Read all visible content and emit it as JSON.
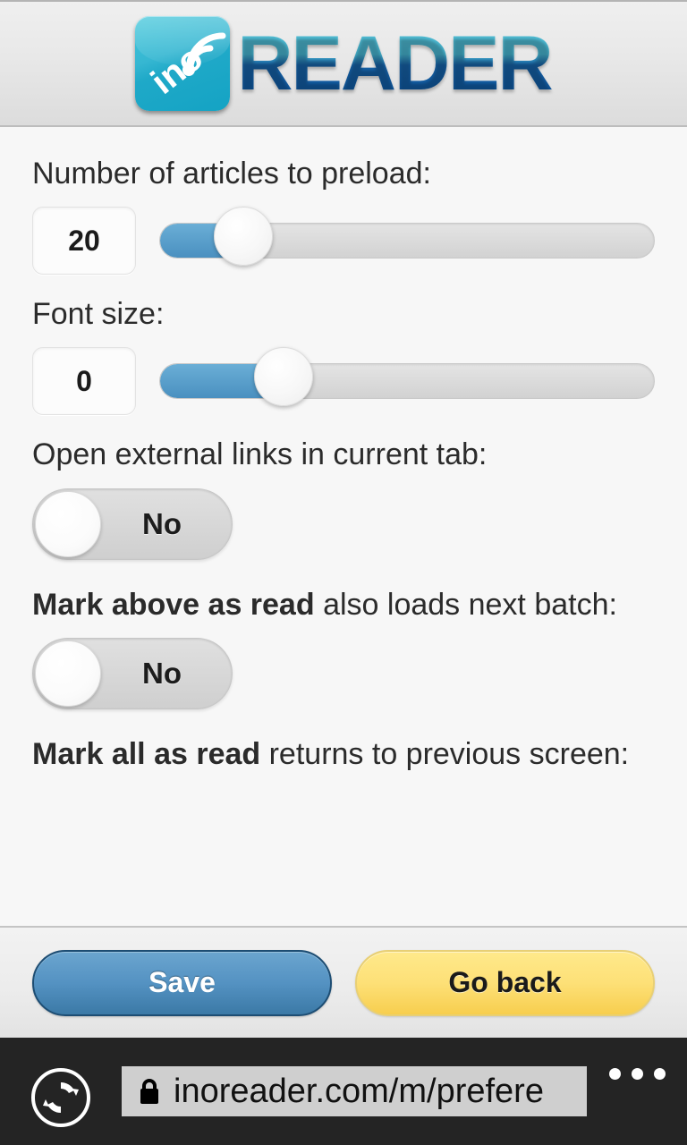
{
  "header": {
    "logo_icon_name": "inoreader-logo-icon",
    "logo_icon_text": "ino",
    "logo_word": "READER"
  },
  "settings": {
    "preload": {
      "label": "Number of articles to preload:",
      "value": "20",
      "slider_percent": 17
    },
    "font_size": {
      "label": "Font size:",
      "value": "0",
      "slider_percent": 25
    },
    "external_links": {
      "label": "Open external links in current tab:",
      "toggle_value": "No"
    },
    "mark_above": {
      "label_bold": "Mark above as read",
      "label_rest": " also loads next batch:",
      "toggle_value": "No"
    },
    "mark_all": {
      "label_bold": "Mark all as read",
      "label_rest": " returns to previous screen:"
    }
  },
  "footer": {
    "save_label": "Save",
    "back_label": "Go back"
  },
  "browser": {
    "refresh_icon": "refresh-icon",
    "lock_icon": "lock-icon",
    "url": "inoreader.com/m/prefere",
    "menu_icon": "more-menu-icon"
  },
  "colors": {
    "accent_blue": "#4a90c0",
    "save_blue": "#5492c2",
    "back_yellow": "#fde077",
    "chrome_dark": "#242424"
  }
}
